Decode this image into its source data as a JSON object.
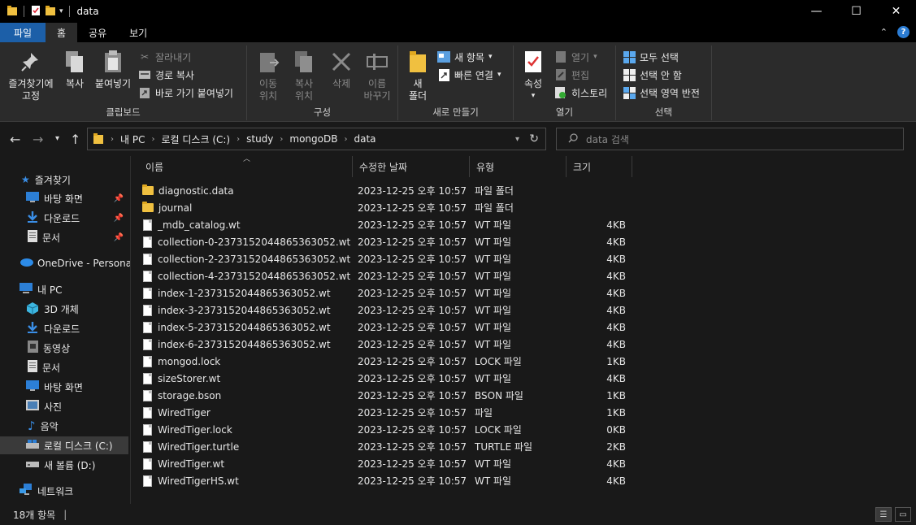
{
  "window": {
    "title": "data",
    "minimize": "—",
    "maximize": "☐",
    "close": "✕"
  },
  "tabs": [
    "파일",
    "홈",
    "공유",
    "보기"
  ],
  "ribbon": {
    "clipboard": {
      "label": "클립보드",
      "pin": "즐겨찾기에\n고정",
      "copy": "복사",
      "paste": "붙여넣기",
      "cut": "잘라내기",
      "copy_path": "경로 복사",
      "paste_shortcut": "바로 가기 붙여넣기"
    },
    "organize": {
      "label": "구성",
      "move": "이동\n위치",
      "copy_to": "복사\n위치",
      "delete": "삭제",
      "rename": "이름\n바꾸기"
    },
    "new": {
      "label": "새로 만들기",
      "new_folder": "새\n폴더",
      "new_item": "새 항목",
      "easy_access": "빠른 연결"
    },
    "open": {
      "label": "열기",
      "properties": "속성",
      "open": "열기",
      "edit": "편집",
      "history": "히스토리"
    },
    "select": {
      "label": "선택",
      "select_all": "모두 선택",
      "select_none": "선택 안 함",
      "invert": "선택 영역 반전"
    }
  },
  "address": {
    "crumbs": [
      "내 PC",
      "로컬 디스크 (C:)",
      "study",
      "mongoDB",
      "data"
    ],
    "search_placeholder": "data 검색"
  },
  "sidebar": {
    "items": [
      {
        "label": "즐겨찾기",
        "icon": "star-icon"
      },
      {
        "label": "바탕 화면",
        "icon": "desktop-icon",
        "pinned": true
      },
      {
        "label": "다운로드",
        "icon": "download-icon",
        "pinned": true
      },
      {
        "label": "문서",
        "icon": "document-icon",
        "pinned": true
      },
      {
        "label": "OneDrive - Personal",
        "icon": "cloud-icon"
      },
      {
        "label": "내 PC",
        "icon": "pc-icon"
      },
      {
        "label": "3D 개체",
        "icon": "3d-icon"
      },
      {
        "label": "다운로드",
        "icon": "download-icon"
      },
      {
        "label": "동영상",
        "icon": "video-icon"
      },
      {
        "label": "문서",
        "icon": "document-icon"
      },
      {
        "label": "바탕 화면",
        "icon": "desktop-icon"
      },
      {
        "label": "사진",
        "icon": "picture-icon"
      },
      {
        "label": "음악",
        "icon": "music-icon"
      },
      {
        "label": "로컬 디스크 (C:)",
        "icon": "disk-icon",
        "selected": true
      },
      {
        "label": "새 볼륨 (D:)",
        "icon": "disk-icon"
      },
      {
        "label": "네트워크",
        "icon": "network-icon"
      }
    ]
  },
  "columns": {
    "name": "이름",
    "date": "수정한 날짜",
    "type": "유형",
    "size": "크기"
  },
  "files": [
    {
      "name": "diagnostic.data",
      "date": "2023-12-25 오후 10:57",
      "type": "파일 폴더",
      "size": "",
      "folder": true
    },
    {
      "name": "journal",
      "date": "2023-12-25 오후 10:57",
      "type": "파일 폴더",
      "size": "",
      "folder": true
    },
    {
      "name": "_mdb_catalog.wt",
      "date": "2023-12-25 오후 10:57",
      "type": "WT 파일",
      "size": "4KB"
    },
    {
      "name": "collection-0-2373152044865363052.wt",
      "date": "2023-12-25 오후 10:57",
      "type": "WT 파일",
      "size": "4KB"
    },
    {
      "name": "collection-2-2373152044865363052.wt",
      "date": "2023-12-25 오후 10:57",
      "type": "WT 파일",
      "size": "4KB"
    },
    {
      "name": "collection-4-2373152044865363052.wt",
      "date": "2023-12-25 오후 10:57",
      "type": "WT 파일",
      "size": "4KB"
    },
    {
      "name": "index-1-2373152044865363052.wt",
      "date": "2023-12-25 오후 10:57",
      "type": "WT 파일",
      "size": "4KB"
    },
    {
      "name": "index-3-2373152044865363052.wt",
      "date": "2023-12-25 오후 10:57",
      "type": "WT 파일",
      "size": "4KB"
    },
    {
      "name": "index-5-2373152044865363052.wt",
      "date": "2023-12-25 오후 10:57",
      "type": "WT 파일",
      "size": "4KB"
    },
    {
      "name": "index-6-2373152044865363052.wt",
      "date": "2023-12-25 오후 10:57",
      "type": "WT 파일",
      "size": "4KB"
    },
    {
      "name": "mongod.lock",
      "date": "2023-12-25 오후 10:57",
      "type": "LOCK 파일",
      "size": "1KB"
    },
    {
      "name": "sizeStorer.wt",
      "date": "2023-12-25 오후 10:57",
      "type": "WT 파일",
      "size": "4KB"
    },
    {
      "name": "storage.bson",
      "date": "2023-12-25 오후 10:57",
      "type": "BSON 파일",
      "size": "1KB"
    },
    {
      "name": "WiredTiger",
      "date": "2023-12-25 오후 10:57",
      "type": "파일",
      "size": "1KB"
    },
    {
      "name": "WiredTiger.lock",
      "date": "2023-12-25 오후 10:57",
      "type": "LOCK 파일",
      "size": "0KB"
    },
    {
      "name": "WiredTiger.turtle",
      "date": "2023-12-25 오후 10:57",
      "type": "TURTLE 파일",
      "size": "2KB"
    },
    {
      "name": "WiredTiger.wt",
      "date": "2023-12-25 오후 10:57",
      "type": "WT 파일",
      "size": "4KB"
    },
    {
      "name": "WiredTigerHS.wt",
      "date": "2023-12-25 오후 10:57",
      "type": "WT 파일",
      "size": "4KB"
    }
  ],
  "status": {
    "count": "18개 항목"
  },
  "colors": {
    "accent": "#1c5fa8",
    "folder": "#f0c040",
    "background": "#191919"
  }
}
